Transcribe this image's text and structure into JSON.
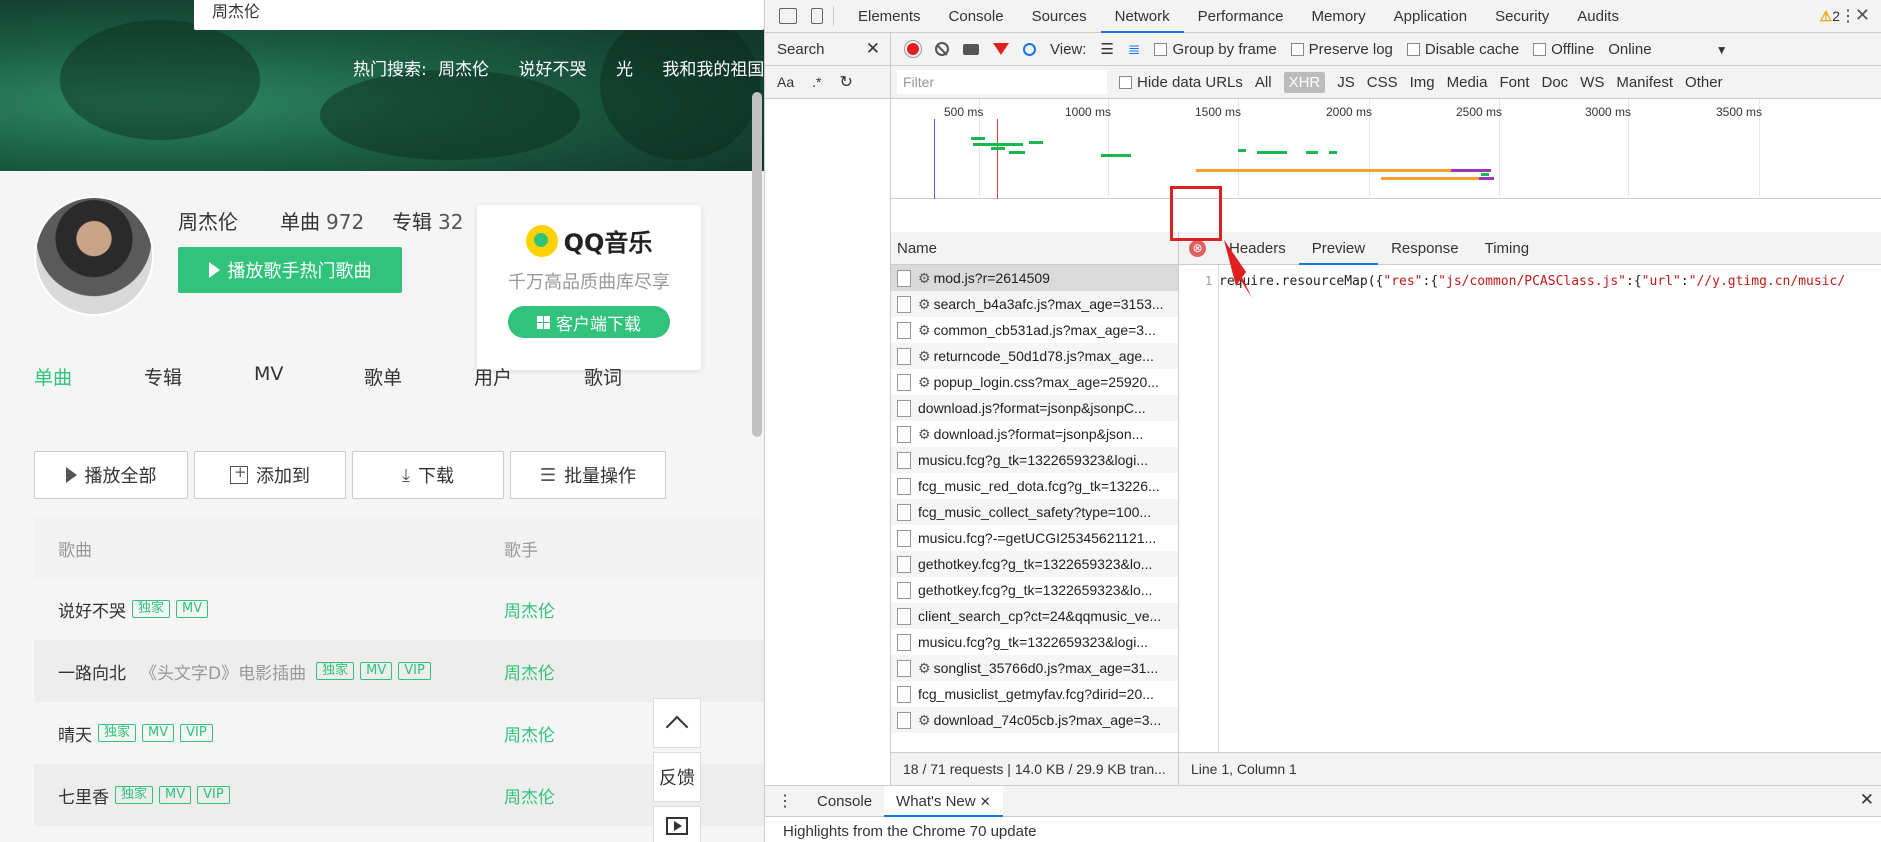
{
  "site": {
    "search_value": "周杰伦",
    "hot_label": "热门搜索:",
    "hot_items": [
      "周杰伦",
      "说好不哭",
      "光",
      "我和我的祖国"
    ],
    "artist": {
      "name": "周杰伦",
      "singles_label": "单曲",
      "singles_count": "972",
      "albums_label": "专辑",
      "albums_count": "32",
      "play_hot_label": "播放歌手热门歌曲"
    },
    "promo": {
      "brand": "QQ音乐",
      "slogan": "千万高品质曲库尽享",
      "download_label": "客户端下载"
    },
    "tabs": [
      "单曲",
      "专辑",
      "MV",
      "歌单",
      "用户",
      "歌词"
    ],
    "toolbar": {
      "play_all": "播放全部",
      "add_to": "添加到",
      "download": "下载",
      "batch": "批量操作"
    },
    "table": {
      "col_song": "歌曲",
      "col_singer": "歌手",
      "rows": [
        {
          "title": "说好不哭",
          "subtitle": "",
          "tags": [
            "独家",
            "MV"
          ],
          "singer": "周杰伦"
        },
        {
          "title": "一路向北",
          "subtitle": "《头文字D》电影插曲",
          "tags": [
            "独家",
            "MV",
            "VIP"
          ],
          "singer": "周杰伦"
        },
        {
          "title": "晴天",
          "subtitle": "",
          "tags": [
            "独家",
            "MV",
            "VIP"
          ],
          "singer": "周杰伦"
        },
        {
          "title": "七里香",
          "subtitle": "",
          "tags": [
            "独家",
            "MV",
            "VIP"
          ],
          "singer": "周杰伦"
        }
      ]
    },
    "float_buttons": {
      "feedback": "反馈"
    }
  },
  "devtools": {
    "tabs": [
      "Elements",
      "Console",
      "Sources",
      "Network",
      "Performance",
      "Memory",
      "Application",
      "Security",
      "Audits"
    ],
    "active_tab": "Network",
    "warning_count": "2",
    "search_panel": {
      "title": "Search",
      "opt_case": "Aa",
      "opt_regex": ".*"
    },
    "network_bar": {
      "view_label": "View:",
      "group_by_frame": "Group by frame",
      "preserve_log": "Preserve log",
      "disable_cache": "Disable cache",
      "offline": "Offline",
      "throttle": "Online"
    },
    "filter_bar": {
      "placeholder": "Filter",
      "hide_data_urls": "Hide data URLs",
      "types": [
        "All",
        "XHR",
        "JS",
        "CSS",
        "Img",
        "Media",
        "Font",
        "Doc",
        "WS",
        "Manifest",
        "Other"
      ],
      "active_type": "XHR"
    },
    "timeline_ticks": [
      "500 ms",
      "1000 ms",
      "1500 ms",
      "2000 ms",
      "2500 ms",
      "3000 ms",
      "3500 ms"
    ],
    "name_header": "Name",
    "requests": [
      {
        "name": "mod.js?r=2614509",
        "gear": true
      },
      {
        "name": "search_b4a3afc.js?max_age=3153...",
        "gear": true
      },
      {
        "name": "common_cb531ad.js?max_age=3...",
        "gear": true
      },
      {
        "name": "returncode_50d1d78.js?max_age...",
        "gear": true
      },
      {
        "name": "popup_login.css?max_age=25920...",
        "gear": true
      },
      {
        "name": "download.js?format=jsonp&jsonpC...",
        "gear": false
      },
      {
        "name": "download.js?format=jsonp&json...",
        "gear": true
      },
      {
        "name": "musicu.fcg?g_tk=1322659323&logi...",
        "gear": false
      },
      {
        "name": "fcg_music_red_dota.fcg?g_tk=13226...",
        "gear": false
      },
      {
        "name": "fcg_music_collect_safety?type=100...",
        "gear": false
      },
      {
        "name": "musicu.fcg?-=getUCGI25345621121...",
        "gear": false
      },
      {
        "name": "gethotkey.fcg?g_tk=1322659323&lo...",
        "gear": false
      },
      {
        "name": "gethotkey.fcg?g_tk=1322659323&lo...",
        "gear": false
      },
      {
        "name": "client_search_cp?ct=24&qqmusic_ve...",
        "gear": false
      },
      {
        "name": "musicu.fcg?g_tk=1322659323&logi...",
        "gear": false
      },
      {
        "name": "songlist_35766d0.js?max_age=31...",
        "gear": true
      },
      {
        "name": "fcg_musiclist_getmyfav.fcg?dirid=20...",
        "gear": false
      },
      {
        "name": "download_74c05cb.js?max_age=3...",
        "gear": true
      }
    ],
    "detail_tabs": [
      "Headers",
      "Preview",
      "Response",
      "Timing"
    ],
    "active_detail_tab": "Preview",
    "close_glyph": "⊗",
    "code": {
      "line_number": "1",
      "prefix": "require.resourceMap({",
      "s1": "\"res\"",
      "colon1": ":{",
      "s2": "\"js/common/PCASClass.js\"",
      "colon2": ":{",
      "s3": "\"url\"",
      "colon3": ":",
      "s4": "\"//y.gtimg.cn/music/"
    },
    "status": {
      "summary": "18 / 71 requests | 14.0 KB / 29.9 KB tran...",
      "cursor": "Line 1, Column 1"
    },
    "drawer": {
      "tabs": [
        "Console",
        "What's New"
      ],
      "active": "What's New",
      "message": "Highlights from the Chrome 70 update"
    },
    "colors": {
      "accent": "#1a73e8",
      "record": "#e02020",
      "annotation": "#e02020"
    }
  },
  "colors": {
    "qq_green": "#31c27c"
  }
}
